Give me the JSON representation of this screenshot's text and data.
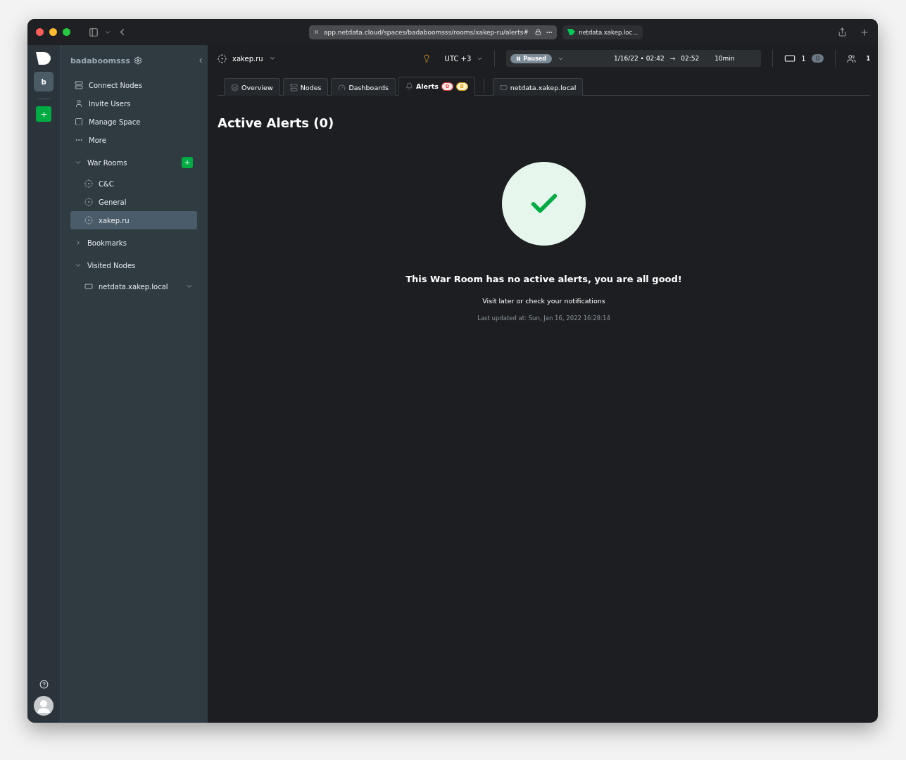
{
  "browser": {
    "url": "app.netdata.cloud/spaces/badaboomsss/rooms/xakep-ru/alerts#",
    "tab_title": "netdata.xakep.loc..."
  },
  "rail": {
    "space_initial": "b"
  },
  "sidebar": {
    "space_name": "badaboomsss",
    "menu": [
      {
        "kind": "nodes",
        "label": "Connect Nodes"
      },
      {
        "kind": "user",
        "label": "Invite Users"
      },
      {
        "kind": "space",
        "label": "Manage Space"
      },
      {
        "kind": "more",
        "label": "More"
      }
    ],
    "sections": [
      {
        "title": "War Rooms",
        "expanded": true,
        "add": true,
        "items": [
          {
            "kind": "room",
            "label": "C&C",
            "selected": false
          },
          {
            "kind": "room",
            "label": "General",
            "selected": false
          },
          {
            "kind": "room",
            "label": "xakep.ru",
            "selected": true
          }
        ]
      },
      {
        "title": "Bookmarks",
        "expanded": false,
        "add": false
      },
      {
        "title": "Visited Nodes",
        "expanded": true,
        "add": false,
        "items": [
          {
            "kind": "node",
            "label": "netdata.xakep.local",
            "selected": false
          }
        ]
      }
    ]
  },
  "topbar": {
    "room": "xakep.ru",
    "timezone": "UTC +3",
    "status": "Paused",
    "range_start": "1/16/22 • 02:42",
    "arrow": "→",
    "range_end": "02:52",
    "duration": "10min",
    "nodes_count": "1",
    "nodes_badge": "0",
    "users_count": "1"
  },
  "tabs": [
    {
      "kind": "overview",
      "label": "Overview",
      "selected": false
    },
    {
      "kind": "nodes",
      "label": "Nodes",
      "selected": false
    },
    {
      "kind": "dashboards",
      "label": "Dashboards",
      "selected": false
    },
    {
      "kind": "alerts",
      "label": "Alerts",
      "selected": true,
      "critical": "0",
      "warning": "0"
    },
    {
      "kind": "node",
      "label": "netdata.xakep.local",
      "selected": false
    }
  ],
  "content": {
    "title": "Active Alerts (0)",
    "message": "This War Room has no active alerts, you are all good!",
    "hint": "Visit later or check your notifications",
    "updated": "Last updated at: Sun, Jan 16, 2022 16:28:14"
  }
}
